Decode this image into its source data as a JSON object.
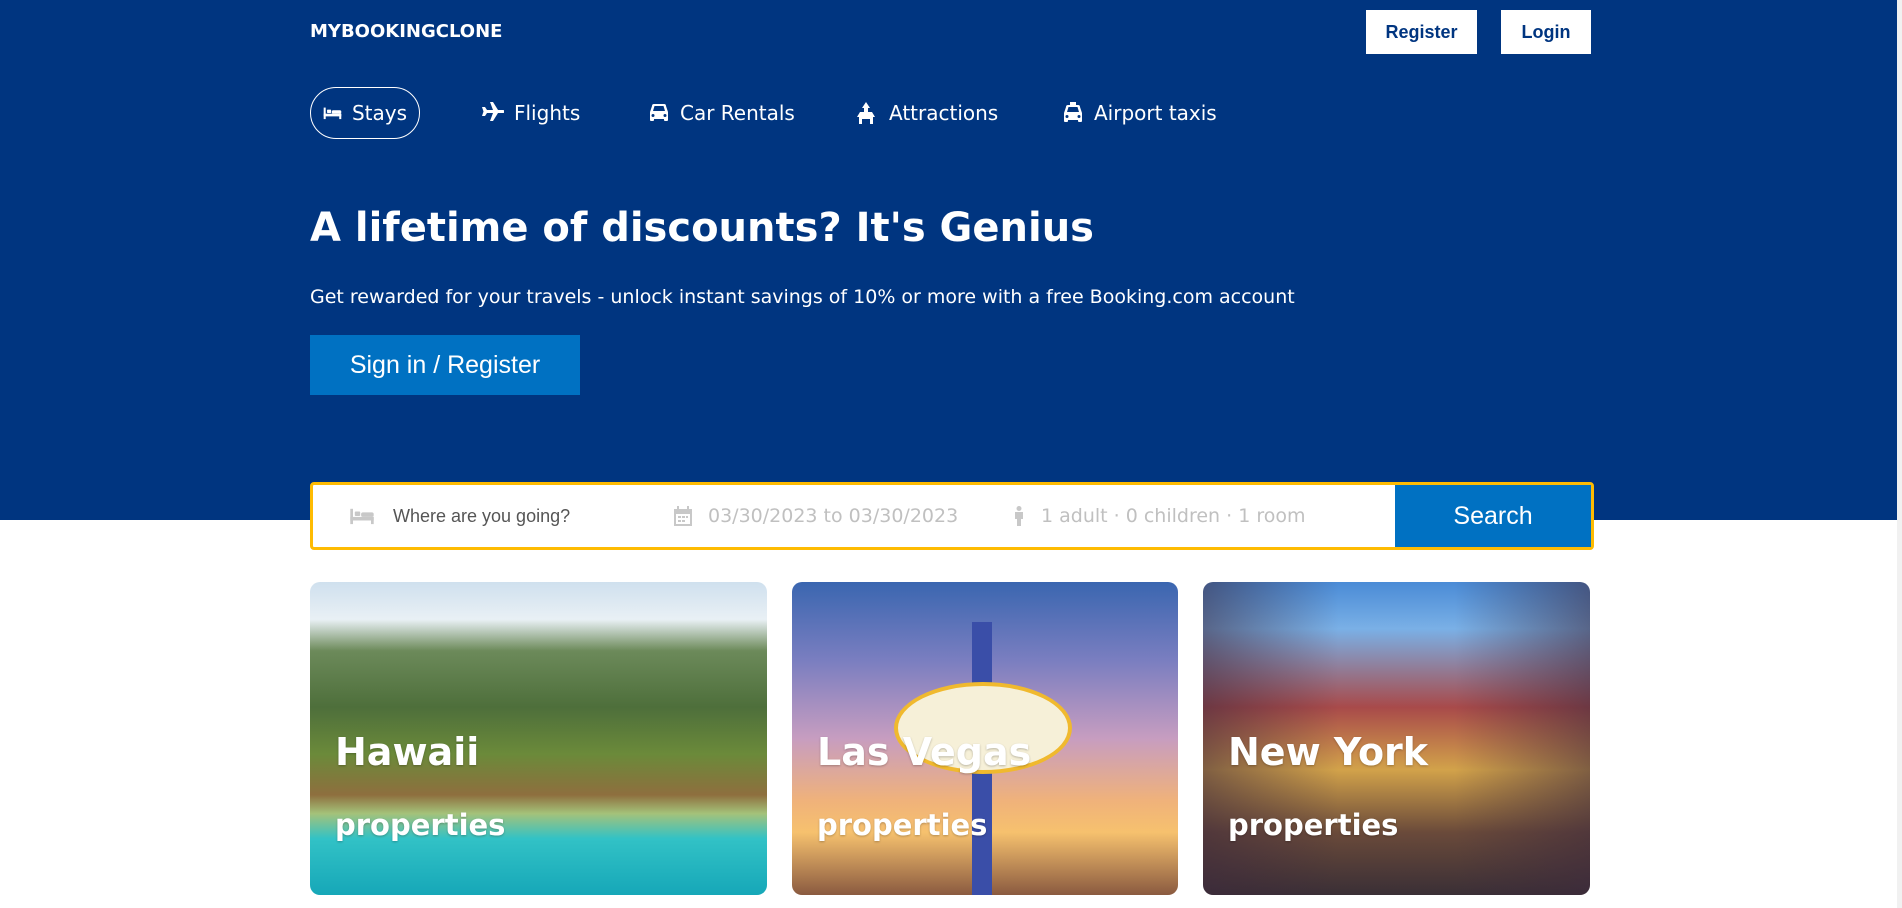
{
  "header": {
    "logo": "MYBOOKINGCLONE",
    "register_label": "Register",
    "login_label": "Login"
  },
  "tabs": [
    {
      "label": "Stays",
      "icon": "bed-icon",
      "active": true
    },
    {
      "label": "Flights",
      "icon": "plane-icon",
      "active": false
    },
    {
      "label": "Car Rentals",
      "icon": "car-icon",
      "active": false
    },
    {
      "label": "Attractions",
      "icon": "attractions-icon",
      "active": false
    },
    {
      "label": "Airport taxis",
      "icon": "taxi-icon",
      "active": false
    }
  ],
  "hero": {
    "title": "A lifetime of discounts? It's Genius",
    "subtitle": "Get rewarded for your travels - unlock instant savings of 10% or more with a free Booking.com account",
    "cta_label": "Sign in / Register"
  },
  "search": {
    "destination_placeholder": "Where are you going?",
    "dates": "03/30/2023 to 03/30/2023",
    "guests": "1 adult · 0 children · 1 room",
    "button_label": "Search"
  },
  "cards": [
    {
      "title": "Hawaii",
      "subtitle": "properties"
    },
    {
      "title": "Las Vegas",
      "subtitle": "properties"
    },
    {
      "title": "New York",
      "subtitle": "properties"
    }
  ],
  "colors": {
    "header_bg": "#003580",
    "primary_button": "#0071c2",
    "search_border": "#febb02"
  }
}
